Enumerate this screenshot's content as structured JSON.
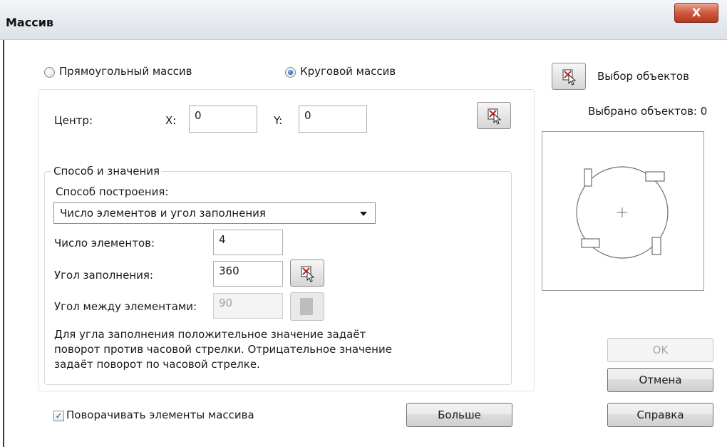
{
  "window": {
    "title": "Массив",
    "close_label": "X"
  },
  "array_type": {
    "rectangular_label": "Прямоугольный массив",
    "circular_label": "Круговой массив",
    "selected": "circular"
  },
  "center": {
    "label": "Центр:",
    "x_label": "X:",
    "x_value": "0",
    "y_label": "Y:",
    "y_value": "0"
  },
  "method_group": {
    "legend": "Способ и значения",
    "method_label": "Способ построения:",
    "method_value": "Число элементов и угол заполнения",
    "count_label": "Число элементов:",
    "count_value": "4",
    "fill_angle_label": "Угол заполнения:",
    "fill_angle_value": "360",
    "between_angle_label": "Угол между элементами:",
    "between_angle_value": "90",
    "note": "Для угла заполнения положительное значение задаёт поворот против часовой стрелки. Отрицательное значение задаёт поворот по часовой стрелке.",
    "note_lines": [
      "Для угла заполнения положительное значение задаёт",
      "поворот против часовой стрелки. Отрицательное значение",
      "задаёт поворот по часовой стрелке."
    ]
  },
  "rotate_items": {
    "label": "Поворачивать элементы массива",
    "checked": true
  },
  "more_button": "Больше",
  "select_objects": {
    "label": "Выбор объектов",
    "count_text": "Выбрано объектов: 0"
  },
  "buttons": {
    "ok": "OK",
    "cancel": "Отмена",
    "help": "Справка"
  },
  "icons": {
    "pick": "pick-point-icon",
    "select": "select-objects-icon",
    "close": "close-icon"
  }
}
